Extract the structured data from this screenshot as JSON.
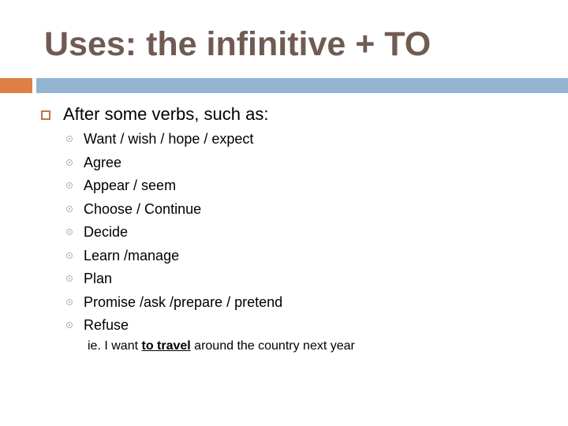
{
  "slide": {
    "title": "Uses: the infinitive + TO",
    "colors": {
      "title": "#705b53",
      "accent_orange": "#df7f46",
      "accent_blue": "#93b4d1",
      "bullet_square": "#c27247",
      "bullet_dot": "#a9b3bd"
    },
    "main_bullet": {
      "icon": "square-bullet-icon",
      "text": "After some verbs, such as:"
    },
    "sub_bullets": [
      {
        "icon": "circle-dot-bullet-icon",
        "text": "Want / wish / hope / expect"
      },
      {
        "icon": "circle-dot-bullet-icon",
        "text": "Agree"
      },
      {
        "icon": "circle-dot-bullet-icon",
        "text": "Appear / seem"
      },
      {
        "icon": "circle-dot-bullet-icon",
        "text": "Choose / Continue"
      },
      {
        "icon": "circle-dot-bullet-icon",
        "text": "Decide"
      },
      {
        "icon": "circle-dot-bullet-icon",
        "text": "Learn /manage"
      },
      {
        "icon": "circle-dot-bullet-icon",
        "text": "Plan"
      },
      {
        "icon": "circle-dot-bullet-icon",
        "text": "Promise /ask /prepare / pretend"
      },
      {
        "icon": "circle-dot-bullet-icon",
        "text": "Refuse"
      }
    ],
    "example": {
      "before": "ie. I want ",
      "emphasis": "to travel",
      "after": " around the country next year"
    }
  }
}
